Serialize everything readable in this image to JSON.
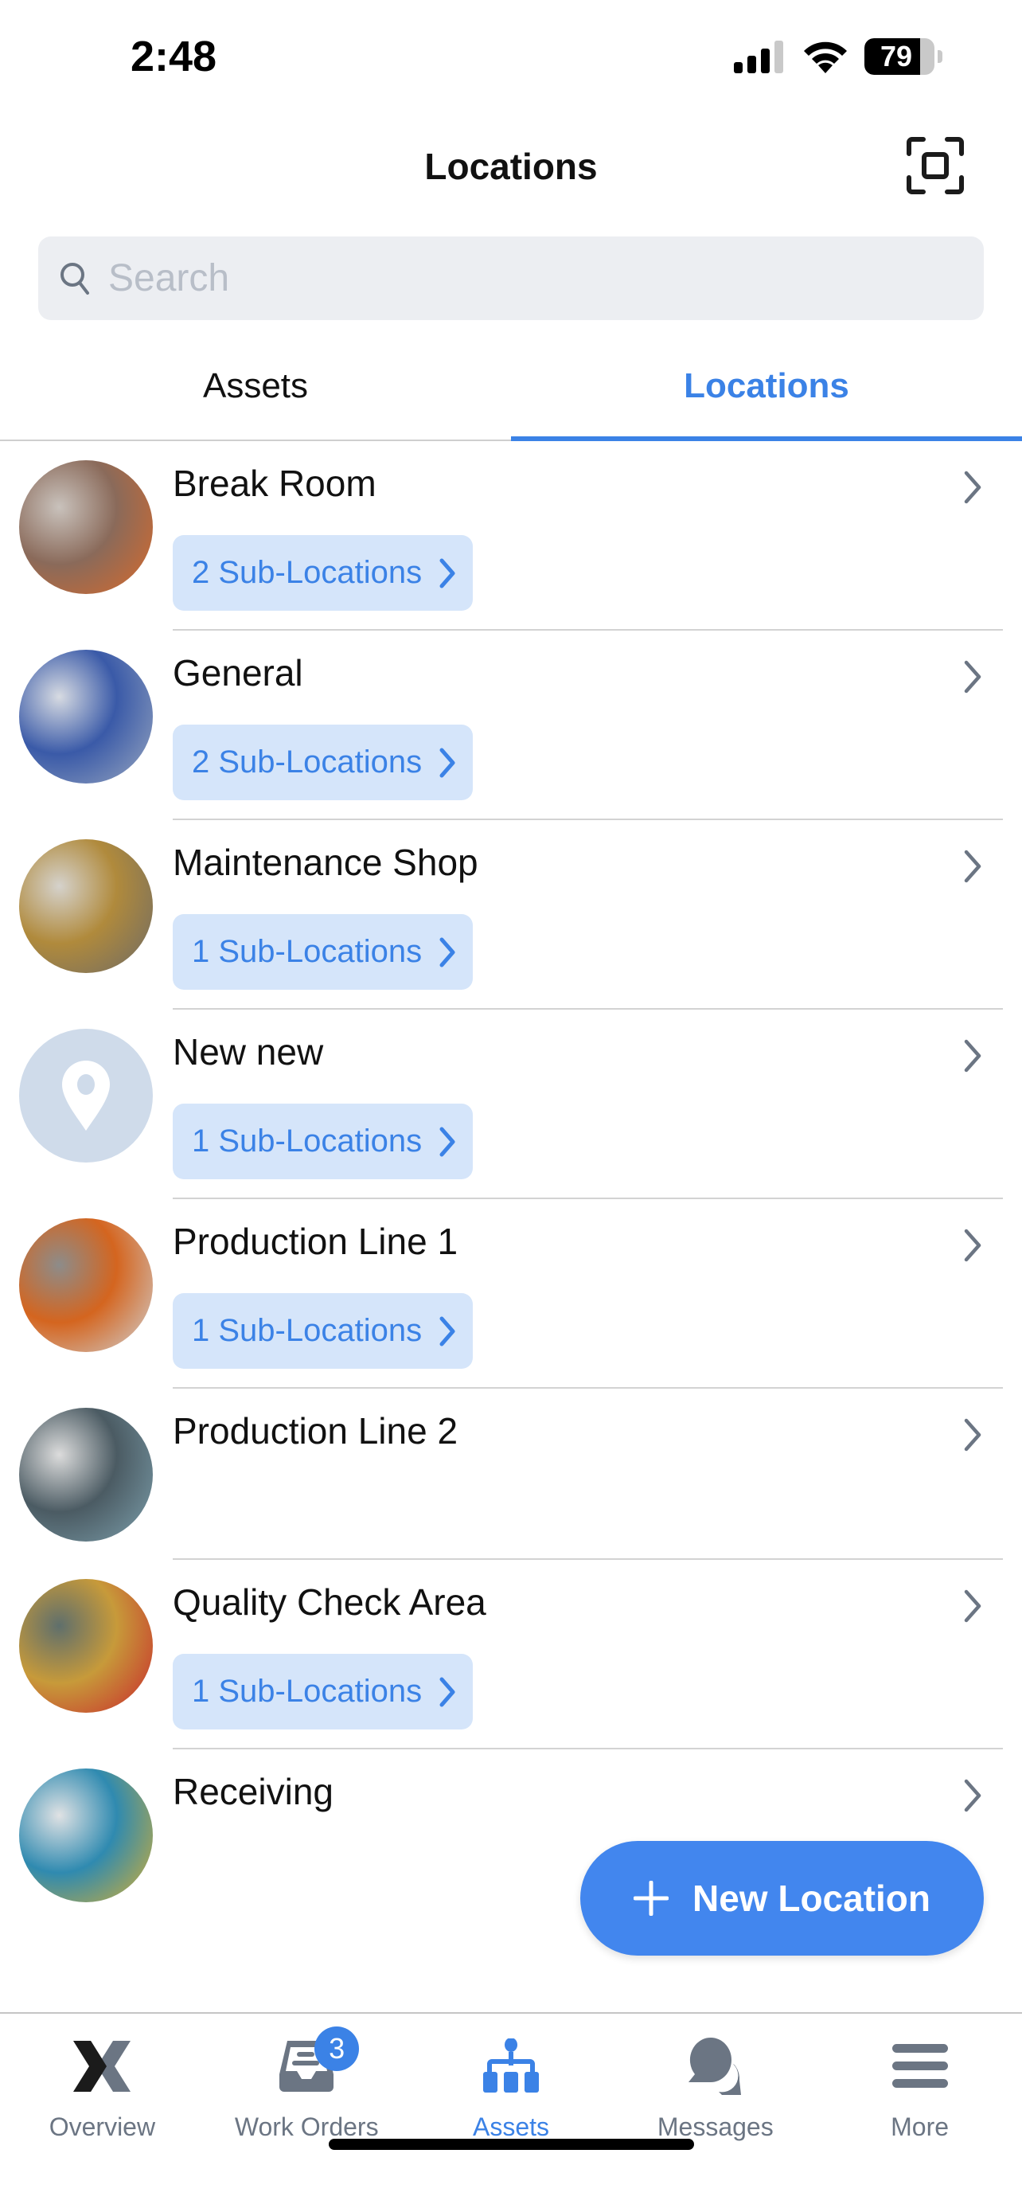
{
  "status_bar": {
    "time": "2:48",
    "battery_percent": 79,
    "battery_label": "79",
    "signal_bars": 3,
    "signal_max": 4
  },
  "header": {
    "title": "Locations",
    "scan_icon": "scan-frame-icon"
  },
  "search": {
    "placeholder": "Search",
    "value": ""
  },
  "segment_tabs": [
    {
      "label": "Assets",
      "active": false
    },
    {
      "label": "Locations",
      "active": true
    }
  ],
  "locations": [
    {
      "name": "Break Room",
      "sub_locations": "2 Sub-Locations",
      "image": "worker-photo",
      "colors": [
        "#8a6a5a",
        "#c9c2bc",
        "#d96a2b"
      ]
    },
    {
      "name": "General",
      "sub_locations": "2 Sub-Locations",
      "image": "factory-floor-photo",
      "colors": [
        "#3a5aa8",
        "#d7dbe2",
        "#9aa8c0"
      ]
    },
    {
      "name": "Maintenance Shop",
      "sub_locations": "1 Sub-Locations",
      "image": "warehouse-photo",
      "colors": [
        "#b08a3c",
        "#d5d2cc",
        "#6d6a66"
      ]
    },
    {
      "name": "New new",
      "sub_locations": "1 Sub-Locations",
      "image": "location-pin-placeholder",
      "colors": []
    },
    {
      "name": "Production Line 1",
      "sub_locations": "1 Sub-Locations",
      "image": "production-photo",
      "colors": [
        "#d4651f",
        "#8d8c8a",
        "#d0d3d6"
      ]
    },
    {
      "name": "Production Line 2",
      "sub_locations": null,
      "image": "engineer-photo",
      "colors": [
        "#4b5b63",
        "#dcdcdc",
        "#7da0ad"
      ]
    },
    {
      "name": "Quality Check Area",
      "sub_locations": "1 Sub-Locations",
      "image": "inspection-photo",
      "colors": [
        "#c79a3a",
        "#5f6f6c",
        "#c8262b"
      ]
    },
    {
      "name": "Receiving",
      "sub_locations": null,
      "image": "loading-dock-photo",
      "colors": [
        "#2f8ab0",
        "#e0e2e4",
        "#d8b030"
      ]
    }
  ],
  "fab": {
    "label": "New Location",
    "icon": "plus-icon"
  },
  "bottom_nav": [
    {
      "label": "Overview",
      "icon": "overview-logo-icon",
      "active": false
    },
    {
      "label": "Work Orders",
      "icon": "inbox-tray-icon",
      "active": false,
      "badge": "3"
    },
    {
      "label": "Assets",
      "icon": "hierarchy-icon",
      "active": true
    },
    {
      "label": "Messages",
      "icon": "chat-bubbles-icon",
      "active": false
    },
    {
      "label": "More",
      "icon": "menu-icon",
      "active": false
    }
  ],
  "colors": {
    "accent": "#3b82e6",
    "fab": "#4286ee",
    "badge_bg": "#d5e5fa",
    "inactive": "#6b7583",
    "search_bg": "#eceef2"
  }
}
